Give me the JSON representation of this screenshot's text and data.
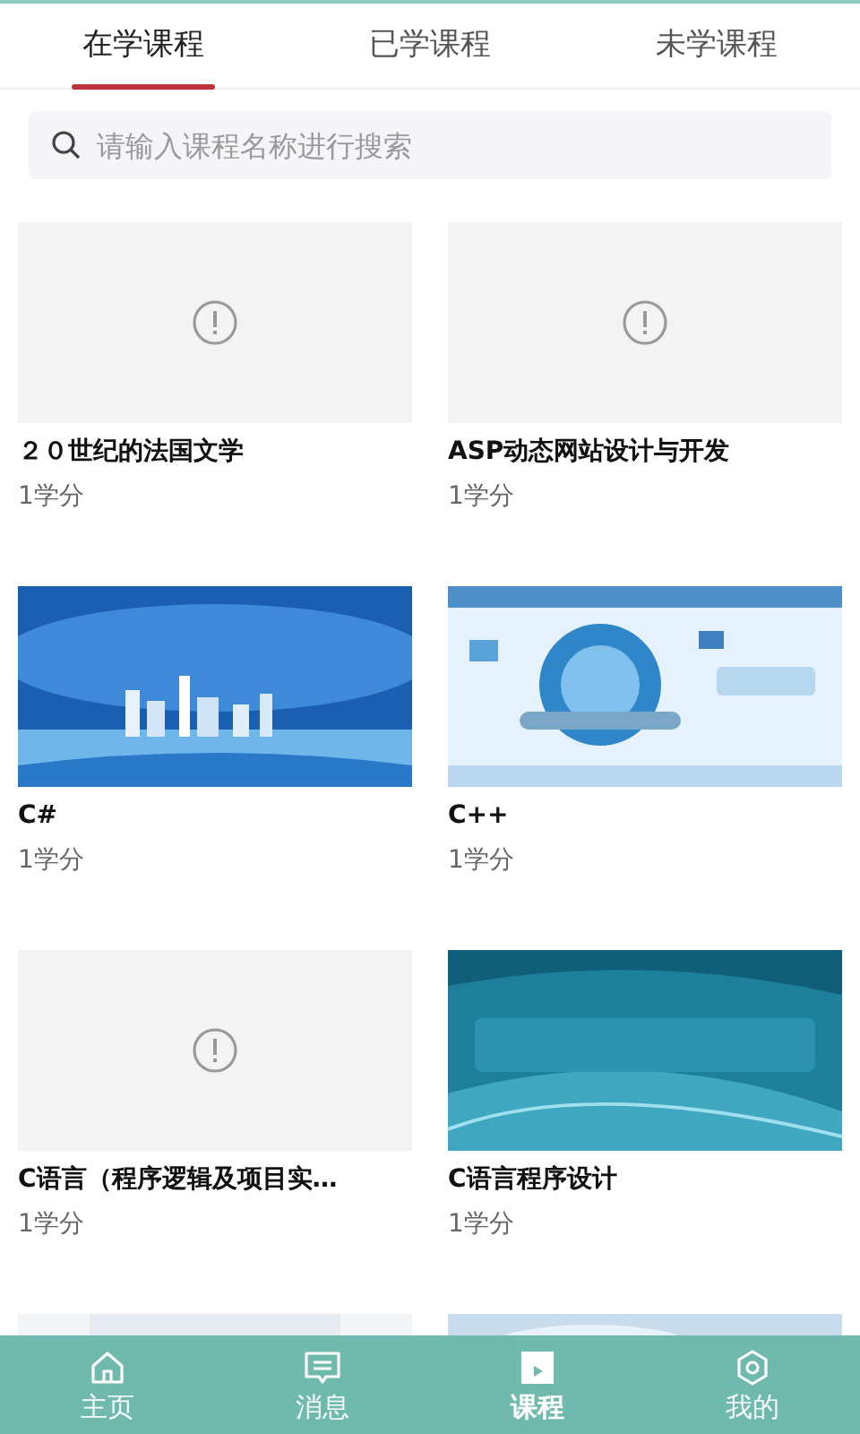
{
  "tabs": [
    {
      "label": "在学课程",
      "selected": true
    },
    {
      "label": "已学课程",
      "selected": false
    },
    {
      "label": "未学课程",
      "selected": false
    }
  ],
  "search": {
    "placeholder": "请输入课程名称进行搜索"
  },
  "courses": [
    {
      "kind": "placeholder",
      "title": "２０世纪的法国文学",
      "credit": "1学分"
    },
    {
      "kind": "placeholder",
      "title": "ASP动态网站设计与开发",
      "credit": "1学分"
    },
    {
      "kind": "picture",
      "title": "C#",
      "credit": "1学分"
    },
    {
      "kind": "picture",
      "title": "C++",
      "credit": "1学分"
    },
    {
      "kind": "placeholder",
      "title": "C语言（程序逻辑及项目实…",
      "credit": "1学分"
    },
    {
      "kind": "picture",
      "title": "C语言程序设计",
      "credit": "1学分"
    },
    {
      "kind": "picture"
    },
    {
      "kind": "picture"
    }
  ],
  "nav": [
    {
      "label": "主页",
      "selected": false
    },
    {
      "label": "消息",
      "selected": false
    },
    {
      "label": "课程",
      "selected": true
    },
    {
      "label": "我的",
      "selected": false
    }
  ]
}
